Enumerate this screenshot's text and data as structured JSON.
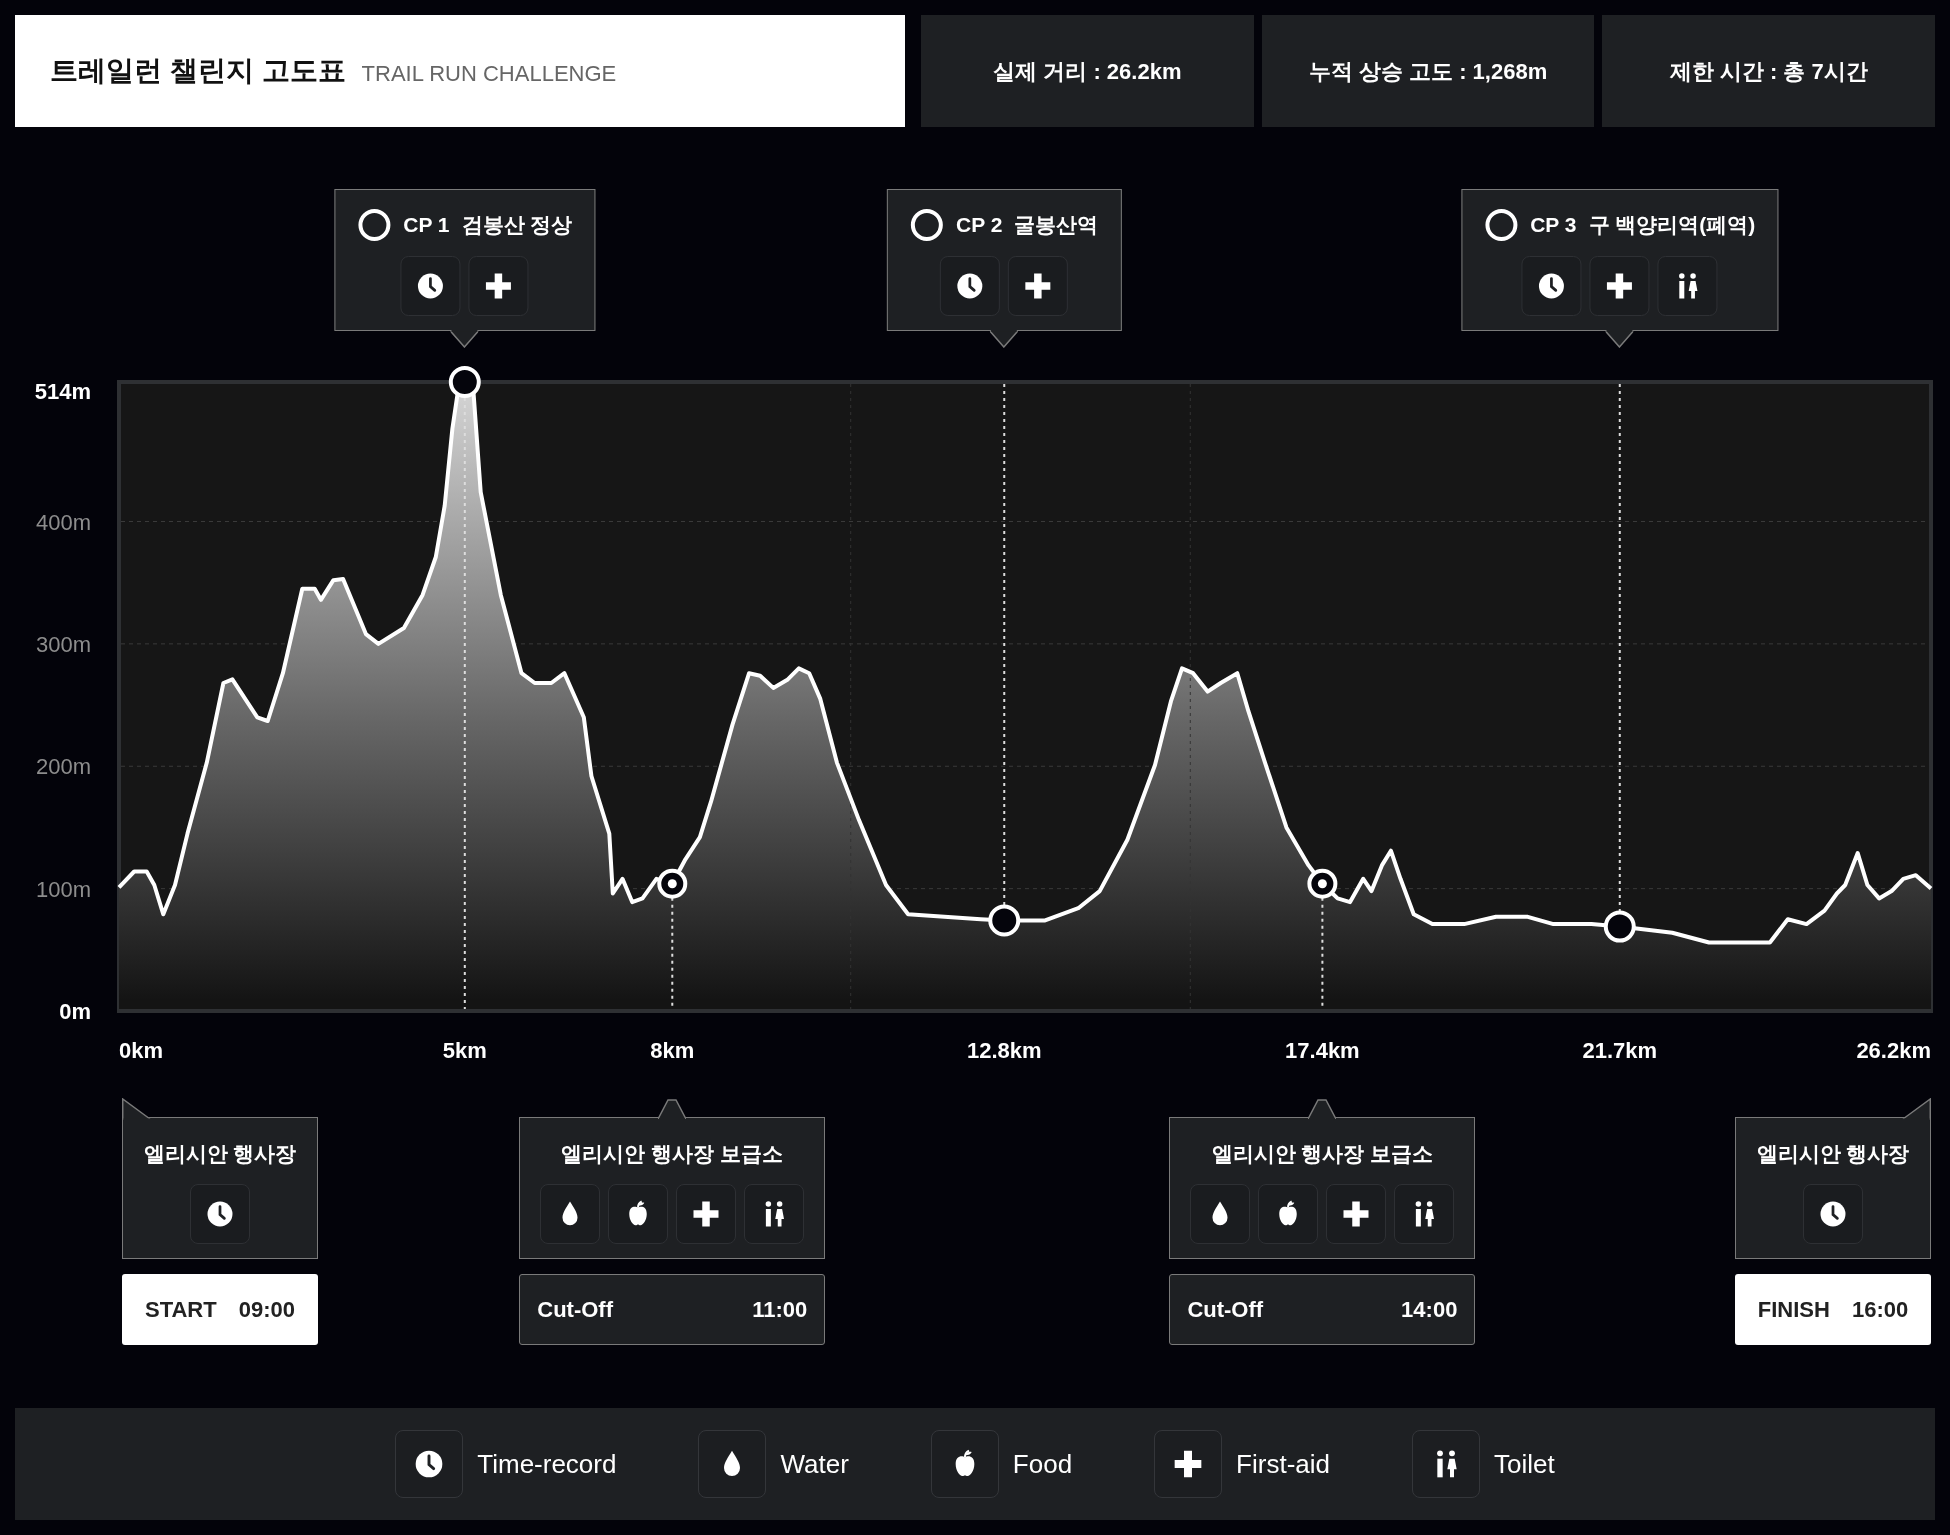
{
  "header": {
    "title": "트레일런 챌린지 고도표",
    "subtitle": "TRAIL RUN CHALLENGE"
  },
  "stats": [
    "실제 거리 : 26.2km",
    "누적 상승 고도 : 1,268m",
    "제한 시간 : 총 7시간"
  ],
  "checkpoints": [
    {
      "label": "CP 1",
      "name": "검봉산 정상",
      "facilities": [
        {
          "kind": "time"
        },
        {
          "kind": "aid"
        }
      ]
    },
    {
      "label": "CP 2",
      "name": "굴봉산역",
      "facilities": [
        {
          "kind": "time"
        },
        {
          "kind": "aid"
        }
      ]
    },
    {
      "label": "CP 3",
      "name": "구 백양리역(폐역)",
      "facilities": [
        {
          "kind": "time"
        },
        {
          "kind": "aid"
        },
        {
          "kind": "toilet"
        }
      ]
    }
  ],
  "markers": [
    {
      "kind": "checkpoint"
    },
    {
      "kind": "supply"
    },
    {
      "kind": "checkpoint"
    },
    {
      "kind": "supply"
    },
    {
      "kind": "checkpoint"
    }
  ],
  "chart_data": {
    "type": "area",
    "x": [
      0,
      0.22,
      0.4,
      0.51,
      0.64,
      0.81,
      0.99,
      1.27,
      1.51,
      1.64,
      2.0,
      2.15,
      2.37,
      2.65,
      2.83,
      2.92,
      3.1,
      3.24,
      3.57,
      3.75,
      4.12,
      4.39,
      4.58,
      4.71,
      4.82,
      4.91,
      5.0,
      5.12,
      5.23,
      5.52,
      5.82,
      6.01,
      6.25,
      6.44,
      6.72,
      6.83,
      7.09,
      7.14,
      7.28,
      7.42,
      7.57,
      7.77,
      8.0,
      8.19,
      8.4,
      8.56,
      8.87,
      9.11,
      9.27,
      9.46,
      9.67,
      9.83,
      9.98,
      10.14,
      10.38,
      10.7,
      11.09,
      11.41,
      12.46,
      12.8,
      13.39,
      13.87,
      14.18,
      14.58,
      14.98,
      15.21,
      15.37,
      15.53,
      15.74,
      15.93,
      16.17,
      16.33,
      16.57,
      16.88,
      17.2,
      17.4,
      17.62,
      17.8,
      17.99,
      18.11,
      18.26,
      18.39,
      18.53,
      18.72,
      18.99,
      19.45,
      19.91,
      20.37,
      20.74,
      21.29,
      21.7,
      22.46,
      22.99,
      23.87,
      24.13,
      24.4,
      24.66,
      24.84,
      24.96,
      25.14,
      25.28,
      25.45,
      25.63,
      25.8,
      25.98,
      26.2
    ],
    "series": [
      {
        "color": "#ffffff",
        "values": [
          101,
          114,
          114,
          103,
          79,
          103,
          145,
          203,
          268,
          271,
          240,
          237,
          276,
          345,
          345,
          336,
          352,
          353,
          308,
          300,
          313,
          340,
          371,
          413,
          476,
          510,
          514,
          510,
          424,
          340,
          276,
          268,
          268,
          276,
          240,
          192,
          145,
          96,
          108,
          89,
          92,
          108,
          104,
          124,
          142,
          171,
          234,
          276,
          274,
          264,
          271,
          280,
          276,
          255,
          203,
          156,
          103,
          79,
          75,
          74,
          74,
          84,
          98,
          140,
          201,
          253,
          280,
          276,
          261,
          268,
          276,
          245,
          203,
          150,
          119,
          104,
          92,
          89,
          108,
          98,
          119,
          131,
          108,
          79,
          71,
          71,
          77,
          77,
          71,
          71,
          69,
          64,
          56,
          56,
          75,
          71,
          82,
          96,
          103,
          129,
          103,
          92,
          98,
          108,
          111,
          100
        ]
      }
    ],
    "xlim": [
      0,
      26.2
    ],
    "ylim": [
      0,
      514
    ],
    "grid": true,
    "ref_lines": [
      {
        "axis": "x",
        "value": 5,
        "color": "#dddddd"
      },
      {
        "axis": "x",
        "value": 8,
        "color": "#dddddd"
      },
      {
        "axis": "x",
        "value": 10.58,
        "color": "#333333"
      },
      {
        "axis": "x",
        "value": 12.8,
        "color": "#dddddd"
      },
      {
        "axis": "x",
        "value": 15.49,
        "color": "#333333"
      },
      {
        "axis": "x",
        "value": 17.4,
        "color": "#dddddd"
      },
      {
        "axis": "x",
        "value": 21.7,
        "color": "#dddddd"
      }
    ],
    "xticks": [
      {
        "value": 0,
        "label": "0km"
      },
      {
        "value": 5,
        "label": "5km"
      },
      {
        "value": 8,
        "label": "8km"
      },
      {
        "value": 12.8,
        "label": "12.8km"
      },
      {
        "value": 17.4,
        "label": "17.4km"
      },
      {
        "value": 21.7,
        "label": "21.7km"
      },
      {
        "value": 26.2,
        "label": "26.2km"
      }
    ],
    "yticks": [
      {
        "value": 0,
        "label": "0m"
      },
      {
        "value": 100,
        "label": "100m"
      },
      {
        "value": 200,
        "label": "200m"
      },
      {
        "value": 300,
        "label": "300m"
      },
      {
        "value": 400,
        "label": "400m"
      },
      {
        "value": 514,
        "label": "514m"
      }
    ]
  },
  "stations": [
    {
      "kind": "start",
      "name": "엘리시안 행사장",
      "facilities": [
        {
          "kind": "time"
        }
      ],
      "time_label": "START",
      "time": "09:00"
    },
    {
      "kind": "supply",
      "name": "엘리시안 행사장 보급소",
      "facilities": [
        {
          "kind": "water"
        },
        {
          "kind": "food"
        },
        {
          "kind": "aid"
        },
        {
          "kind": "toilet"
        }
      ],
      "time_label": "Cut-Off",
      "time": "11:00"
    },
    {
      "kind": "supply",
      "name": "엘리시안 행사장 보급소",
      "facilities": [
        {
          "kind": "water"
        },
        {
          "kind": "food"
        },
        {
          "kind": "aid"
        },
        {
          "kind": "toilet"
        }
      ],
      "time_label": "Cut-Off",
      "time": "14:00"
    },
    {
      "kind": "finish",
      "name": "엘리시안 행사장",
      "facilities": [
        {
          "kind": "time"
        }
      ],
      "time_label": "FINISH",
      "time": "16:00"
    }
  ],
  "legend": [
    {
      "kind": "time",
      "label": "Time-record"
    },
    {
      "kind": "water",
      "label": "Water"
    },
    {
      "kind": "food",
      "label": "Food"
    },
    {
      "kind": "aid",
      "label": "First-aid"
    },
    {
      "kind": "toilet",
      "label": "Toilet"
    }
  ]
}
